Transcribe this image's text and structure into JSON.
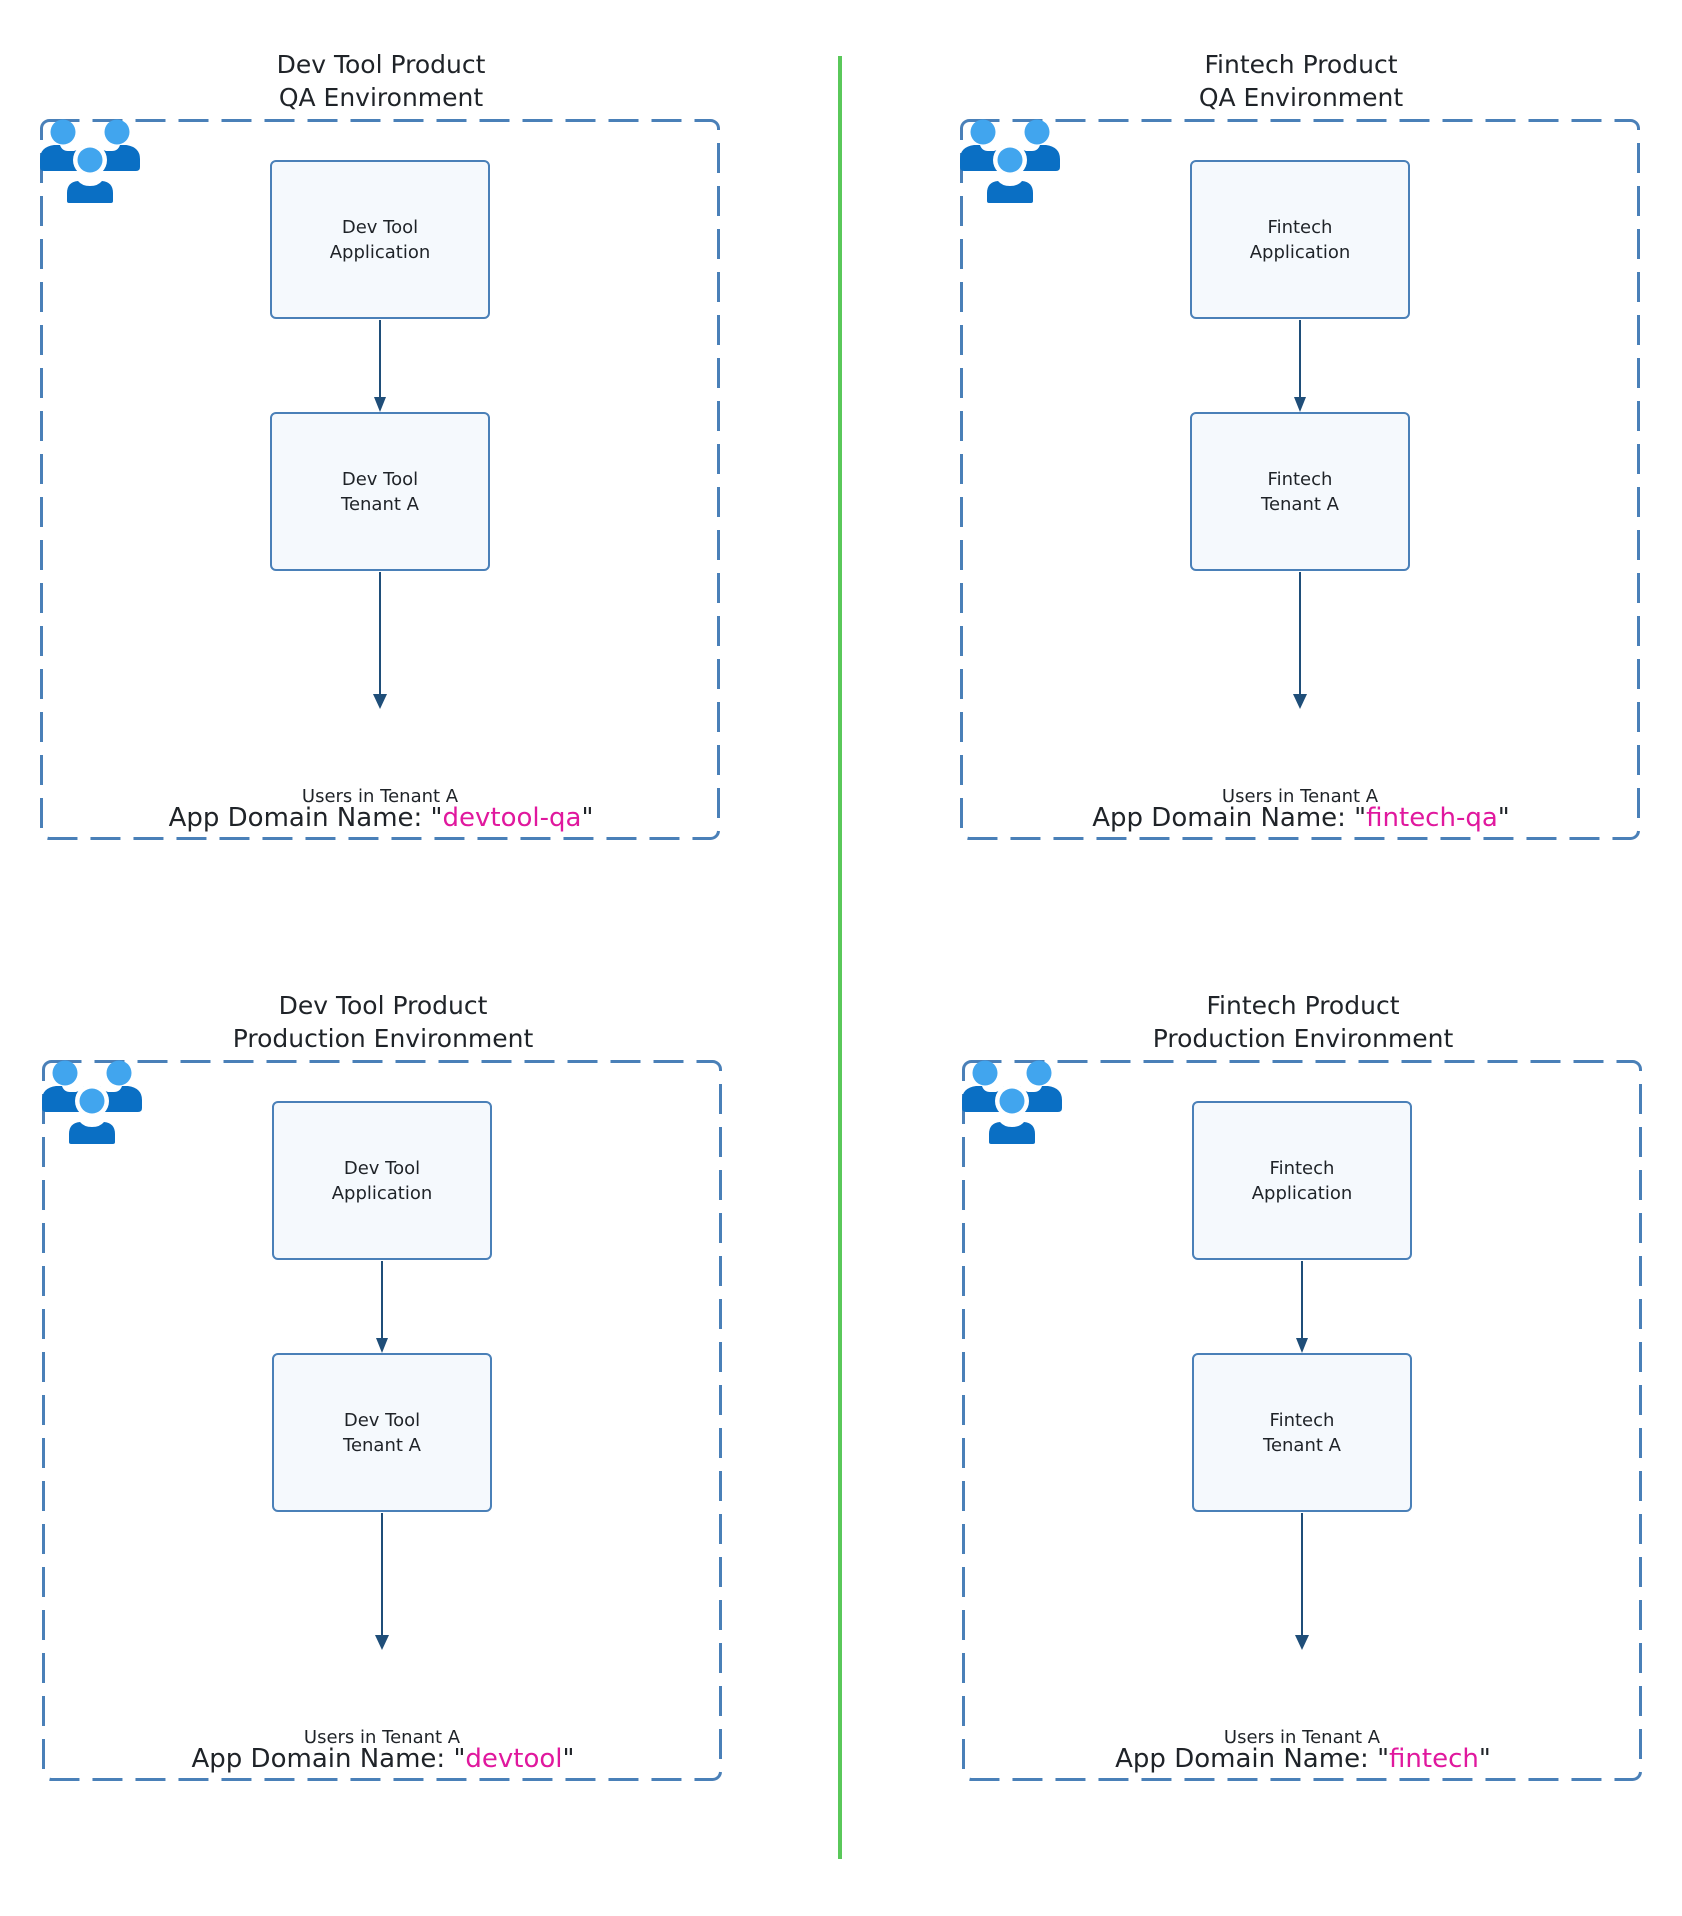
{
  "colors": {
    "divider": "#5ac85a",
    "env_border": "#4a80b8",
    "node_border": "#4a80b8",
    "node_fill": "#f5f9fd",
    "arrow": "#1f4e79",
    "user_head": "#41a5ee",
    "user_body": "#0a6fc4",
    "domain_highlight": "#e0189e",
    "text": "#1f2328"
  },
  "panels": [
    {
      "id": "devtool-qa",
      "title_line1": "Dev Tool Product",
      "title_line2": "QA Environment",
      "app_node": [
        "Dev Tool",
        "Application"
      ],
      "tenant_node": [
        "Dev Tool",
        "Tenant A"
      ],
      "users_icon": "users-group-icon",
      "users_label": "Users in Tenant A",
      "domain_prefix": "App Domain Name: \"",
      "domain_value": "devtool-qa",
      "domain_suffix": "\""
    },
    {
      "id": "fintech-qa",
      "title_line1": "Fintech Product",
      "title_line2": "QA Environment",
      "app_node": [
        "Fintech",
        "Application"
      ],
      "tenant_node": [
        "Fintech",
        "Tenant A"
      ],
      "users_icon": "users-group-icon",
      "users_label": "Users in Tenant A",
      "domain_prefix": "App Domain Name: \"",
      "domain_value": "fintech-qa",
      "domain_suffix": "\""
    },
    {
      "id": "devtool-prod",
      "title_line1": "Dev Tool Product",
      "title_line2": "Production Environment",
      "app_node": [
        "Dev Tool",
        "Application"
      ],
      "tenant_node": [
        "Dev Tool",
        "Tenant A"
      ],
      "users_icon": "users-group-icon",
      "users_label": "Users in Tenant A",
      "domain_prefix": "App Domain Name: \"",
      "domain_value": "devtool",
      "domain_suffix": "\""
    },
    {
      "id": "fintech-prod",
      "title_line1": "Fintech Product",
      "title_line2": "Production Environment",
      "app_node": [
        "Fintech",
        "Application"
      ],
      "tenant_node": [
        "Fintech",
        "Tenant A"
      ],
      "users_icon": "users-group-icon",
      "users_label": "Users in Tenant A",
      "domain_prefix": "App Domain Name: \"",
      "domain_value": "fintech",
      "domain_suffix": "\""
    }
  ]
}
